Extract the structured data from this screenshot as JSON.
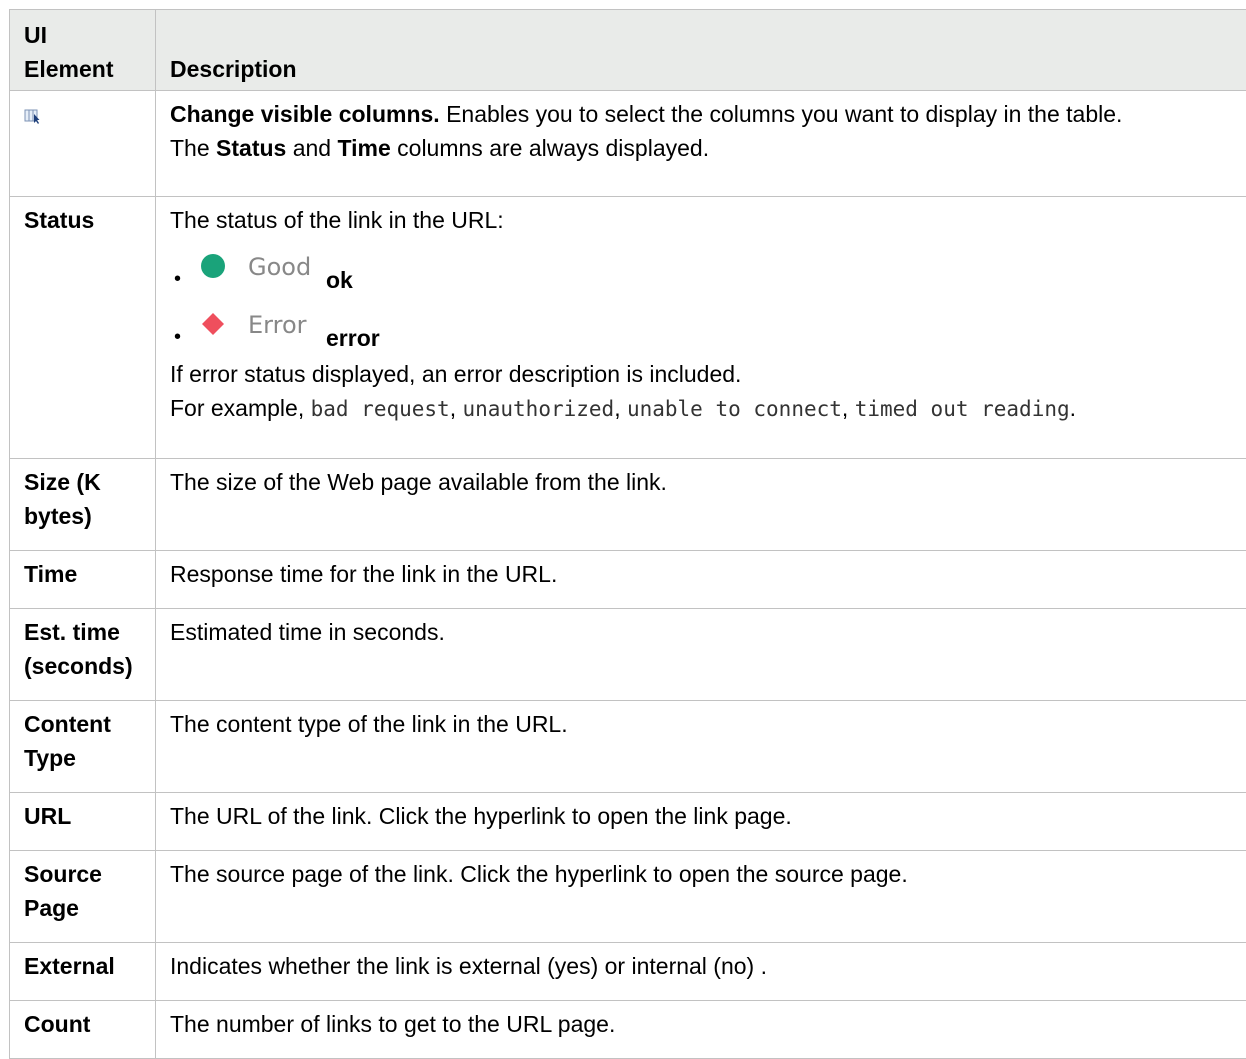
{
  "header": {
    "col1": "UI Element",
    "col2": "Description"
  },
  "rows": {
    "columns_icon": {
      "icon": "change-visible-columns-icon",
      "title": "Change visible columns.",
      "text": " Enables you to select the columns you want to display in the table.",
      "line2_pre": "The ",
      "line2_b1": "Status",
      "line2_mid": " and ",
      "line2_b2": "Time",
      "line2_post": " columns are always displayed."
    },
    "status": {
      "element": "Status",
      "intro": "The status of the link in the URL:",
      "good_label": "Good",
      "good_word": "ok",
      "error_label": "Error",
      "error_word": "error",
      "good_color": "#1aa37a",
      "error_color": "#ef4f5d",
      "note": "If error status displayed, an error description is included.",
      "example_pre": "For example, ",
      "ex1": "bad request",
      "ex2": "unauthorized",
      "ex3": "unable to connect",
      "ex4": "timed out reading",
      "sep": ", ",
      "end": "."
    },
    "size": {
      "element": "Size (K bytes)",
      "desc": "The size of the Web page available from the link."
    },
    "time": {
      "element": "Time",
      "desc": "Response time for the link in the URL."
    },
    "est_time": {
      "element": "Est. time (seconds)",
      "desc": "Estimated time in seconds."
    },
    "content_type": {
      "element": "Content Type",
      "desc": "The content type of the link in the URL."
    },
    "url": {
      "element": "URL",
      "desc": "The URL of the link. Click the hyperlink to open the link page."
    },
    "source_page": {
      "element": "Source Page",
      "desc": "The source page of the link. Click the hyperlink to open the source page."
    },
    "external": {
      "element": "External",
      "desc": "Indicates whether the link is external (yes) or internal (no) ."
    },
    "count": {
      "element": "Count",
      "desc": "The number of links to get to the URL page."
    }
  }
}
